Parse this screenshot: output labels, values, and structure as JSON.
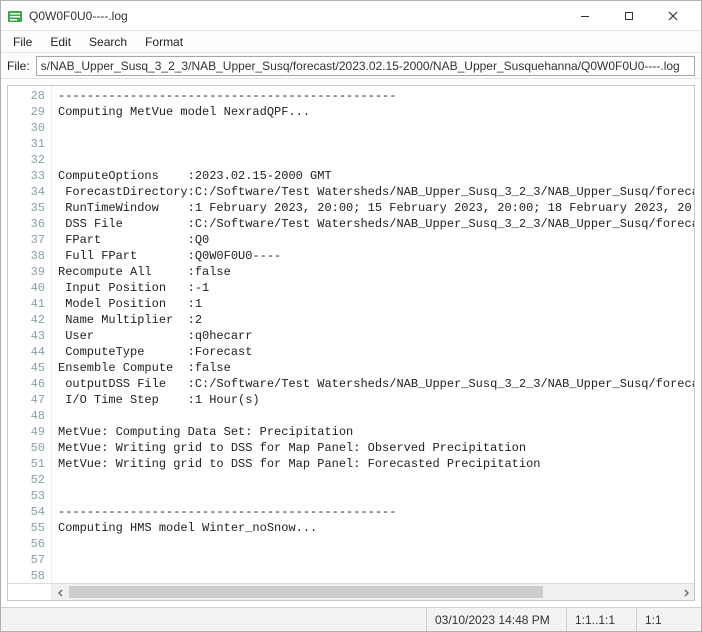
{
  "window": {
    "title": "Q0W0F0U0----.log"
  },
  "menu": {
    "file": "File",
    "edit": "Edit",
    "search": "Search",
    "format": "Format"
  },
  "filebar": {
    "label": "File:",
    "path": "s/NAB_Upper_Susq_3_2_3/NAB_Upper_Susq/forecast/2023.02.15-2000/NAB_Upper_Susquehanna/Q0W0F0U0----.log"
  },
  "editor": {
    "first_line_no": 28,
    "lines": [
      "-----------------------------------------------",
      "Computing MetVue model NexradQPF...",
      "",
      "",
      "",
      "ComputeOptions    :2023.02.15-2000 GMT",
      " ForecastDirectory:C:/Software/Test Watersheds/NAB_Upper_Susq_3_2_3/NAB_Upper_Susq/foreca",
      " RunTimeWindow    :1 February 2023, 20:00; 15 February 2023, 20:00; 18 February 2023, 20:",
      " DSS File         :C:/Software/Test Watersheds/NAB_Upper_Susq_3_2_3/NAB_Upper_Susq/foreca",
      " FPart            :Q0",
      " Full FPart       :Q0W0F0U0----",
      "Recompute All     :false",
      " Input Position   :-1",
      " Model Position   :1",
      " Name Multiplier  :2",
      " User             :q0hecarr",
      " ComputeType      :Forecast",
      "Ensemble Compute  :false",
      " outputDSS File   :C:/Software/Test Watersheds/NAB_Upper_Susq_3_2_3/NAB_Upper_Susq/foreca",
      " I/O Time Step    :1 Hour(s)",
      "",
      "MetVue: Computing Data Set: Precipitation",
      "MetVue: Writing grid to DSS for Map Panel: Observed Precipitation",
      "MetVue: Writing grid to DSS for Map Panel: Forecasted Precipitation",
      "",
      "",
      "-----------------------------------------------",
      "Computing HMS model Winter_noSnow...",
      "",
      "",
      ""
    ]
  },
  "status": {
    "datetime": "03/10/2023 14:48 PM",
    "pos": "1:1..1:1",
    "sel": "1:1"
  }
}
